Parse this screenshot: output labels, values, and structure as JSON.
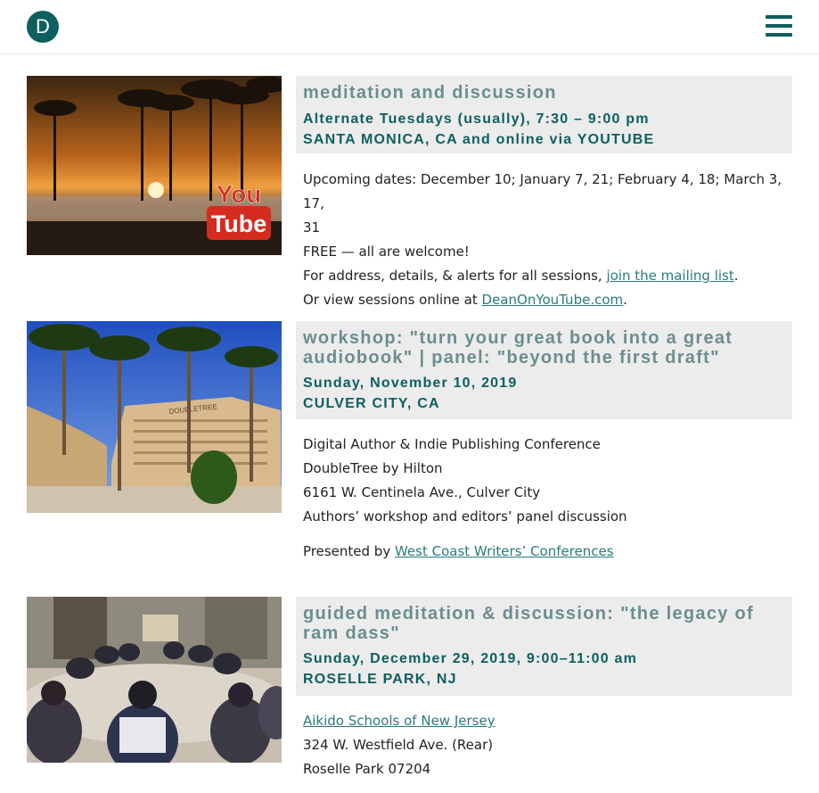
{
  "header": {
    "logo_letter": "D",
    "menu_icon": "hamburger-menu-icon"
  },
  "colors": {
    "brand": "#0e5f5f",
    "title": "#6b8e8e",
    "title_bg": "#ececec",
    "link": "#2a7b7b"
  },
  "events": [
    {
      "title": "meditation and discussion",
      "date": "Alternate Tuesdays (usually), 7:30 – 9:00 pm",
      "location": "SANTA MONICA, CA and online via YOUTUBE",
      "image_overlay": {
        "line1": "You",
        "line2": "Tube"
      },
      "line1": "Upcoming dates: December 10; January 7, 21; February 4, 18; March 3, 17,",
      "line1b": "31",
      "line2": "FREE — all are welcome!",
      "line3_prefix": "For address, details, & alerts for all sessions, ",
      "line3_link": "join the mailing list",
      "line3_suffix": ".",
      "line4_prefix": "Or view sessions online at ",
      "line4_link": "DeanOnYouTube.com",
      "line4_suffix": "."
    },
    {
      "title_line1": "workshop: \"turn your great book into a great",
      "title_line2": "audiobook\" | panel: \"beyond the first draft\"",
      "date": "Sunday, November 10, 2019",
      "location": "CULVER CITY, CA",
      "image_sign": "DOUBLETREE",
      "line1": "Digital Author & Indie Publishing Conference",
      "line2": "DoubleTree by Hilton",
      "line3": "6161 W. Centinela Ave., Culver City",
      "line4": "Authors’ workshop and editors’ panel discussion",
      "presented_prefix": "Presented by ",
      "presented_link": "West Coast Writers’ Conferences"
    },
    {
      "title_line1": "guided meditation & discussion: \"the legacy of",
      "title_line2": "ram dass\"",
      "date": "Sunday, December 29, 2019, 9:00–11:00 am",
      "location": "ROSELLE PARK, NJ",
      "line1_link": "Aikido Schools of New Jersey",
      "line2": "324 W. Westfield Ave. (Rear)",
      "line3": "Roselle Park 07204"
    }
  ]
}
